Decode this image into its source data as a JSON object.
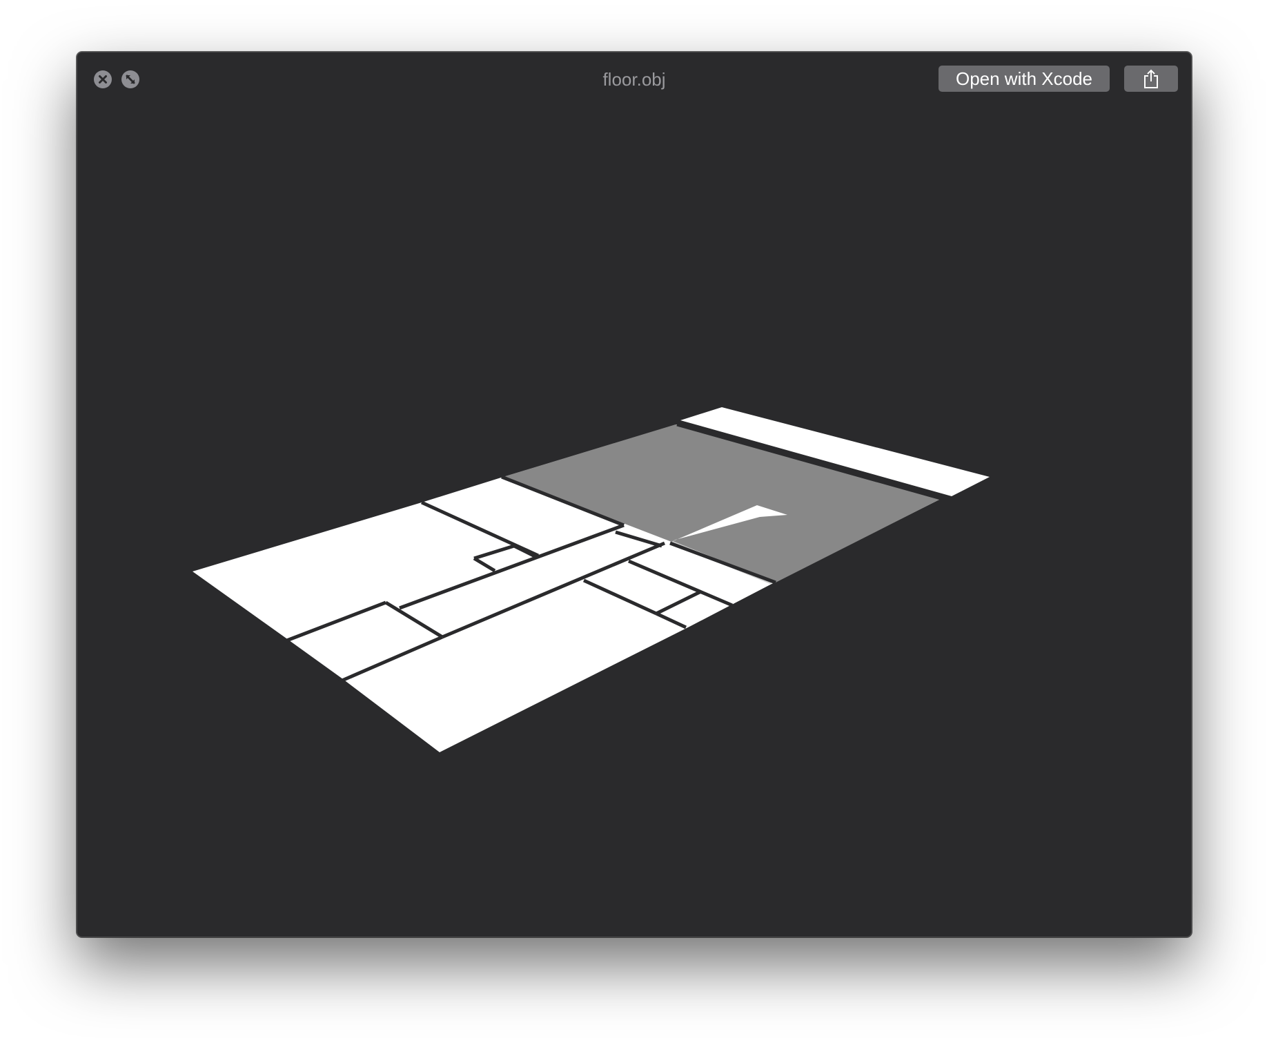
{
  "window": {
    "title": "floor.obj"
  },
  "toolbar": {
    "open_with_label": "Open with Xcode",
    "share_icon": "share-icon"
  },
  "controls": {
    "close_icon": "close-icon",
    "fullscreen_icon": "fullscreen-icon"
  },
  "viewport": {
    "content": "3D floor plan model preview",
    "colors": {
      "background": "#2a2a2c",
      "room_fill": "#ffffff",
      "selected_room_fill": "#888888",
      "wall_gap": "#2a2a2c"
    }
  }
}
